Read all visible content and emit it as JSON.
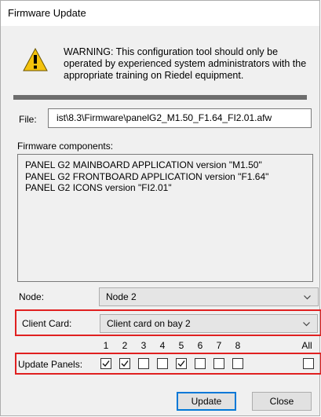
{
  "window": {
    "title": "Firmware Update"
  },
  "warning": {
    "icon": "warning-triangle-icon",
    "text": "WARNING: This configuration tool should only be operated by experienced system administrators with the appropriate training on Riedel equipment."
  },
  "file": {
    "label": "File:",
    "value": "ist\\8.3\\Firmware\\panelG2_M1.50_F1.64_FI2.01.afw"
  },
  "components": {
    "label": "Firmware components:",
    "items": [
      "PANEL G2 MAINBOARD APPLICATION version \"M1.50\"",
      "PANEL G2 FRONTBOARD APPLICATION version \"F1.64\"",
      "PANEL G2 ICONS version \"FI2.01\""
    ]
  },
  "node": {
    "label": "Node:",
    "value": "Node 2"
  },
  "client_card": {
    "label": "Client Card:",
    "value": "Client card on bay 2"
  },
  "panels": {
    "label": "Update Panels:",
    "columns": [
      "1",
      "2",
      "3",
      "4",
      "5",
      "6",
      "7",
      "8",
      "All"
    ],
    "checked": [
      true,
      true,
      false,
      false,
      true,
      false,
      false,
      false,
      false
    ]
  },
  "buttons": {
    "update": "Update",
    "close": "Close"
  },
  "colors": {
    "highlight": "#e02020",
    "default_button_border": "#0078d7"
  }
}
